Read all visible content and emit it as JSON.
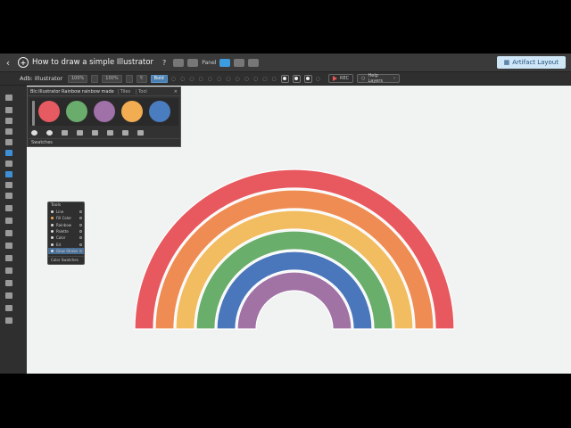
{
  "window": {
    "back_icon": "‹",
    "title": "How to draw a simple Illustrator",
    "help": "?",
    "mini_label": "Panel",
    "layout_button": "Artifact Layout"
  },
  "toolbar": {
    "doc_name": "Adb: Illustrator",
    "fields": [
      "100%",
      "",
      "100%",
      "",
      "Y:",
      "Bold"
    ],
    "record_label": "REC",
    "search_placeholder": "Help Layers"
  },
  "swatches": {
    "header": "Blc:Illustrator Rainbow rainbow made",
    "tabs": [
      "Tiles",
      "Tool"
    ],
    "close": "×",
    "colors": [
      {
        "name": "red",
        "hex": "#e65a62"
      },
      {
        "name": "green",
        "hex": "#6aac6c"
      },
      {
        "name": "purple",
        "hex": "#a070a8"
      },
      {
        "name": "orange",
        "hex": "#f2ac52"
      },
      {
        "name": "blue",
        "hex": "#4a7cc0"
      }
    ],
    "footer": "Swatches"
  },
  "layers": {
    "header": "Tools",
    "items": [
      "Line",
      "Fill Color",
      "Rainbow",
      "Palette",
      "Color",
      "Ed",
      "Glow Stroke"
    ],
    "footer": "Color Swatches"
  },
  "rainbow": {
    "colors": [
      "#e8585f",
      "#ef8c53",
      "#f2bc61",
      "#6aae6b",
      "#4a77bb",
      "#a173a5"
    ],
    "outline": "#ffffff",
    "background": "#f1f3f3"
  }
}
